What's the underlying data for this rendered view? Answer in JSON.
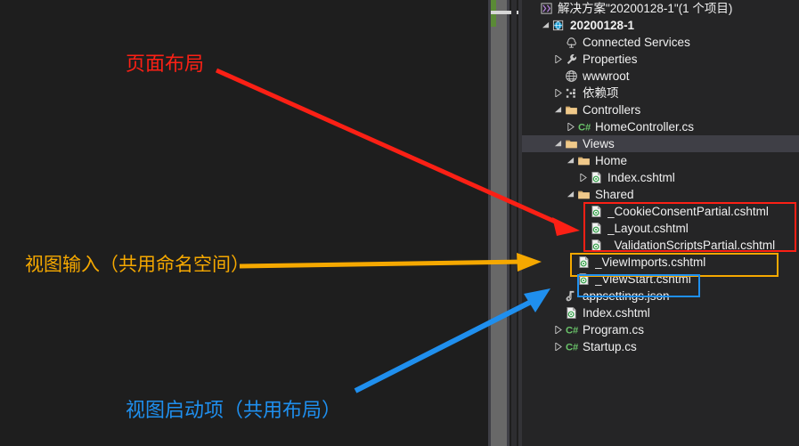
{
  "explorer": {
    "name": "solution-explorer",
    "rows": [
      {
        "indent": 0,
        "expander": "none",
        "icon": "solution-icon",
        "label": "解决方案\"20200128-1\"(1 个项目)",
        "bold": false,
        "selected": false
      },
      {
        "indent": 1,
        "expander": "expanded",
        "icon": "web-project-icon",
        "label": "20200128-1",
        "bold": true,
        "selected": false
      },
      {
        "indent": 2,
        "expander": "none",
        "icon": "connected-services-icon",
        "label": "Connected Services",
        "bold": false,
        "selected": false
      },
      {
        "indent": 2,
        "expander": "collapsed",
        "icon": "wrench-icon",
        "label": "Properties",
        "bold": false,
        "selected": false
      },
      {
        "indent": 2,
        "expander": "none",
        "icon": "globe-icon",
        "label": "wwwroot",
        "bold": false,
        "selected": false
      },
      {
        "indent": 2,
        "expander": "collapsed",
        "icon": "dependencies-icon",
        "label": "依赖项",
        "bold": false,
        "selected": false
      },
      {
        "indent": 2,
        "expander": "expanded",
        "icon": "folder-icon",
        "label": "Controllers",
        "bold": false,
        "selected": false
      },
      {
        "indent": 3,
        "expander": "collapsed",
        "icon": "csharp-icon",
        "label": "HomeController.cs",
        "bold": false,
        "selected": false
      },
      {
        "indent": 2,
        "expander": "expanded",
        "icon": "folder-icon",
        "label": "Views",
        "bold": false,
        "selected": true
      },
      {
        "indent": 3,
        "expander": "expanded",
        "icon": "folder-icon",
        "label": "Home",
        "bold": false,
        "selected": false
      },
      {
        "indent": 4,
        "expander": "collapsed",
        "icon": "cshtml-icon",
        "label": "Index.cshtml",
        "bold": false,
        "selected": false
      },
      {
        "indent": 3,
        "expander": "expanded",
        "icon": "folder-icon",
        "label": "Shared",
        "bold": false,
        "selected": false
      },
      {
        "indent": 4,
        "expander": "none",
        "icon": "cshtml-icon",
        "label": "_CookieConsentPartial.cshtml",
        "bold": false,
        "selected": false
      },
      {
        "indent": 4,
        "expander": "none",
        "icon": "cshtml-icon",
        "label": "_Layout.cshtml",
        "bold": false,
        "selected": false
      },
      {
        "indent": 4,
        "expander": "none",
        "icon": "cshtml-icon",
        "label": "_ValidationScriptsPartial.cshtml",
        "bold": false,
        "selected": false
      },
      {
        "indent": 3,
        "expander": "none",
        "icon": "cshtml-icon",
        "label": "_ViewImports.cshtml",
        "bold": false,
        "selected": false
      },
      {
        "indent": 3,
        "expander": "none",
        "icon": "cshtml-icon",
        "label": "_ViewStart.cshtml",
        "bold": false,
        "selected": false
      },
      {
        "indent": 2,
        "expander": "none",
        "icon": "json-icon",
        "label": "appsettings.json",
        "bold": false,
        "selected": false
      },
      {
        "indent": 2,
        "expander": "none",
        "icon": "cshtml-icon",
        "label": "Index.cshtml",
        "bold": false,
        "selected": false
      },
      {
        "indent": 2,
        "expander": "collapsed",
        "icon": "csharp-icon",
        "label": "Program.cs",
        "bold": false,
        "selected": false
      },
      {
        "indent": 2,
        "expander": "collapsed",
        "icon": "csharp-icon",
        "label": "Startup.cs",
        "bold": false,
        "selected": false
      }
    ]
  },
  "annotations": {
    "layout": {
      "text": "页面布局",
      "color": "#fb2015",
      "target": "_Layout.cshtml group (Shared partial views)"
    },
    "viewimports": {
      "text": "视图输入（共用命名空间）",
      "color": "#f5a800",
      "target": "_ViewImports.cshtml"
    },
    "viewstart": {
      "text": "视图启动项（共用布局）",
      "color": "#1f8fee",
      "target": "_ViewStart.cshtml"
    }
  },
  "colors": {
    "background": "#1e1e1e",
    "panel": "#252526",
    "selection": "#3f3f46",
    "text": "#f0f0f0",
    "folder": "#dcb67a",
    "csharp_green": "#6ac46a",
    "red": "#fb2015",
    "yellow": "#f5a800",
    "blue": "#1f8fee",
    "scrollbar": "#686868",
    "scroll_marker_green": "#5a8a36"
  },
  "scrollbar": {
    "name": "vertical-scrollbar",
    "thumb_visible": true,
    "marker_green": true
  }
}
